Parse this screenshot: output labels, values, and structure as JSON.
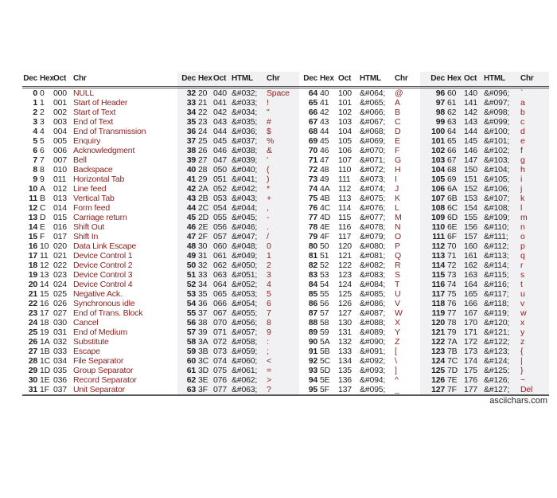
{
  "headers": {
    "group1": [
      "Dec",
      "Hex",
      "Oct",
      "Chr"
    ],
    "group2": [
      "Dec",
      "Hex",
      "Oct",
      "HTML",
      "Chr"
    ],
    "group3": [
      "Dec",
      "Hex",
      "Oct",
      "HTML",
      "Chr"
    ],
    "group4": [
      "Dec",
      "Hex",
      "Oct",
      "HTML",
      "Chr"
    ]
  },
  "colors": {
    "char_text": "#8b1e1e",
    "shaded_column": "#f1f1f3"
  },
  "control_rows": [
    [
      "0",
      "0",
      "000",
      "NULL"
    ],
    [
      "1",
      "1",
      "001",
      "Start of Header"
    ],
    [
      "2",
      "2",
      "002",
      "Start of Text"
    ],
    [
      "3",
      "3",
      "003",
      "End of Text"
    ],
    [
      "4",
      "4",
      "004",
      "End of Transmission"
    ],
    [
      "5",
      "5",
      "005",
      "Enquiry"
    ],
    [
      "6",
      "6",
      "006",
      "Acknowledgment"
    ],
    [
      "7",
      "7",
      "007",
      "Bell"
    ],
    [
      "8",
      "8",
      "010",
      "Backspace"
    ],
    [
      "9",
      "9",
      "011",
      "Horizontal Tab"
    ],
    [
      "10",
      "A",
      "012",
      "Line feed"
    ],
    [
      "11",
      "B",
      "013",
      "Vertical Tab"
    ],
    [
      "12",
      "C",
      "014",
      "Form feed"
    ],
    [
      "13",
      "D",
      "015",
      "Carriage return"
    ],
    [
      "14",
      "E",
      "016",
      "Shift Out"
    ],
    [
      "15",
      "F",
      "017",
      "Shift In"
    ],
    [
      "16",
      "10",
      "020",
      "Data Link Escape"
    ],
    [
      "17",
      "11",
      "021",
      "Device Control 1"
    ],
    [
      "18",
      "12",
      "022",
      "Device Control 2"
    ],
    [
      "19",
      "13",
      "023",
      "Device Control 3"
    ],
    [
      "20",
      "14",
      "024",
      "Device Control 4"
    ],
    [
      "21",
      "15",
      "025",
      "Negative Ack."
    ],
    [
      "22",
      "16",
      "026",
      "Synchronous idle"
    ],
    [
      "23",
      "17",
      "027",
      "End of Trans. Block"
    ],
    [
      "24",
      "18",
      "030",
      "Cancel"
    ],
    [
      "25",
      "19",
      "031",
      "End of Medium"
    ],
    [
      "26",
      "1A",
      "032",
      "Substitute"
    ],
    [
      "27",
      "1B",
      "033",
      "Escape"
    ],
    [
      "28",
      "1C",
      "034",
      "File Separator"
    ],
    [
      "29",
      "1D",
      "035",
      "Group Separator"
    ],
    [
      "30",
      "1E",
      "036",
      "Record Separator"
    ],
    [
      "31",
      "1F",
      "037",
      "Unit Separator"
    ]
  ],
  "printable_chars": {
    "group2": [
      "Space",
      "!",
      "\"",
      "#",
      "$",
      "%",
      "&",
      "'",
      "(",
      ")",
      "*",
      "+",
      ",",
      "-",
      ".",
      "/",
      "0",
      "1",
      "2",
      "3",
      "4",
      "5",
      "6",
      "7",
      "8",
      "9",
      ":",
      ";",
      "<",
      "=",
      ">",
      "?"
    ],
    "group3": [
      "@",
      "A",
      "B",
      "C",
      "D",
      "E",
      "F",
      "G",
      "H",
      "I",
      "J",
      "K",
      "L",
      "M",
      "N",
      "O",
      "P",
      "Q",
      "R",
      "S",
      "T",
      "U",
      "V",
      "W",
      "X",
      "Y",
      "Z",
      "[",
      "\\",
      "]",
      "^",
      "_"
    ],
    "group4": [
      "`",
      "a",
      "b",
      "c",
      "d",
      "e",
      "f",
      "g",
      "h",
      "i",
      "j",
      "k",
      "l",
      "m",
      "n",
      "o",
      "p",
      "q",
      "r",
      "s",
      "t",
      "u",
      "v",
      "w",
      "x",
      "y",
      "z",
      "{",
      "|",
      "}",
      "~",
      "Del"
    ]
  },
  "credit": "asciichars.com"
}
